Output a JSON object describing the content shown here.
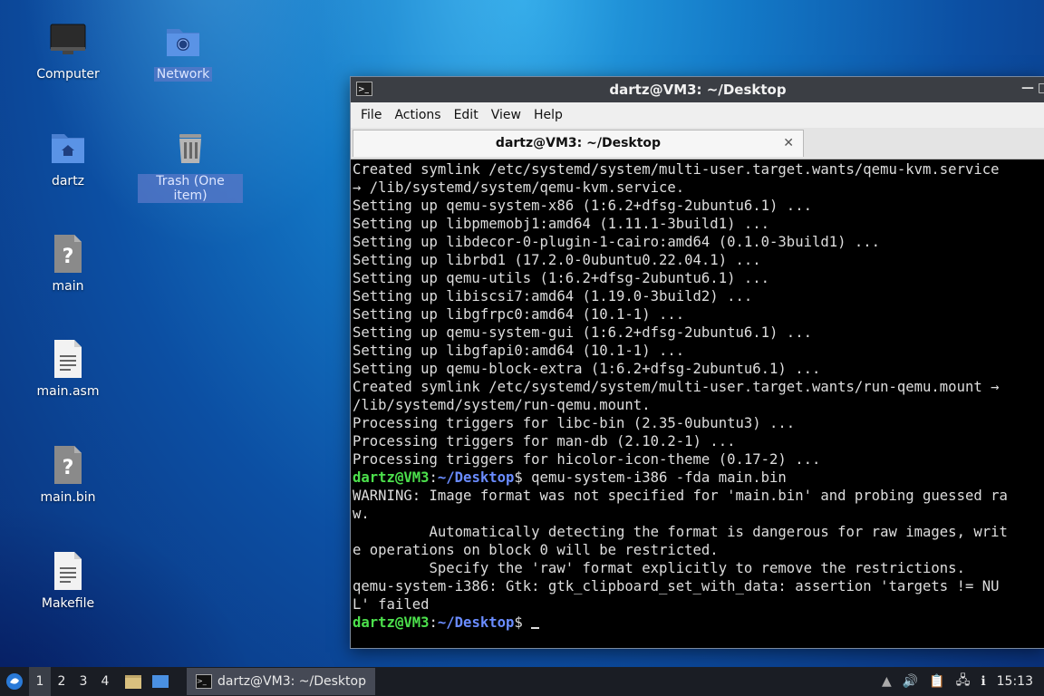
{
  "desktop": {
    "icons": [
      {
        "label": "Computer",
        "icon": "computer-icon"
      },
      {
        "label": "Network",
        "icon": "network-folder-icon"
      },
      {
        "label": "dartz",
        "icon": "home-folder-icon"
      },
      {
        "label": "Trash (One item)",
        "icon": "trash-icon"
      },
      {
        "label": "main",
        "icon": "unknown-file-icon"
      },
      {
        "label": "main.asm",
        "icon": "text-file-icon"
      },
      {
        "label": "main.bin",
        "icon": "unknown-file-icon"
      },
      {
        "label": "Makefile",
        "icon": "text-file-icon"
      }
    ]
  },
  "terminal": {
    "title": "dartz@VM3: ~/Desktop",
    "menu": [
      "File",
      "Actions",
      "Edit",
      "View",
      "Help"
    ],
    "tab_label": "dartz@VM3: ~/Desktop",
    "lines": [
      "Created symlink /etc/systemd/system/multi-user.target.wants/qemu-kvm.service",
      "→ /lib/systemd/system/qemu-kvm.service.",
      "Setting up qemu-system-x86 (1:6.2+dfsg-2ubuntu6.1) ...",
      "Setting up libpmemobj1:amd64 (1.11.1-3build1) ...",
      "Setting up libdecor-0-plugin-1-cairo:amd64 (0.1.0-3build1) ...",
      "Setting up librbd1 (17.2.0-0ubuntu0.22.04.1) ...",
      "Setting up qemu-utils (1:6.2+dfsg-2ubuntu6.1) ...",
      "Setting up libiscsi7:amd64 (1.19.0-3build2) ...",
      "Setting up libgfrpc0:amd64 (10.1-1) ...",
      "Setting up qemu-system-gui (1:6.2+dfsg-2ubuntu6.1) ...",
      "Setting up libgfapi0:amd64 (10.1-1) ...",
      "Setting up qemu-block-extra (1:6.2+dfsg-2ubuntu6.1) ...",
      "Created symlink /etc/systemd/system/multi-user.target.wants/run-qemu.mount →",
      "/lib/systemd/system/run-qemu.mount.",
      "Processing triggers for libc-bin (2.35-0ubuntu3) ...",
      "Processing triggers for man-db (2.10.2-1) ...",
      "Processing triggers for hicolor-icon-theme (0.17-2) ..."
    ],
    "prompt_user": "dartz@VM3",
    "prompt_path": "~/Desktop",
    "command": " qemu-system-i386 -fda main.bin",
    "output_lines": [
      "WARNING: Image format was not specified for 'main.bin' and probing guessed ra",
      "w.",
      "         Automatically detecting the format is dangerous for raw images, writ",
      "e operations on block 0 will be restricted.",
      "         Specify the 'raw' format explicitly to remove the restrictions.",
      "qemu-system-i386: Gtk: gtk_clipboard_set_with_data: assertion 'targets != NU",
      "L' failed"
    ],
    "colors": {
      "user": "#4ce04c",
      "path": "#6a8cff",
      "bg": "#000000"
    }
  },
  "taskbar": {
    "workspaces": [
      "1",
      "2",
      "3",
      "4"
    ],
    "task_label": "dartz@VM3: ~/Desktop",
    "clock": "15:13"
  }
}
